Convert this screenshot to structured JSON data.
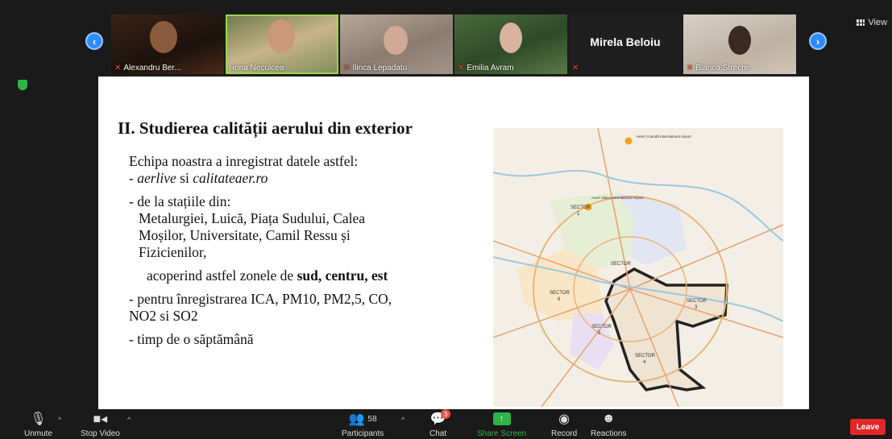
{
  "window": {
    "view_label": "View",
    "view_icon": "grid-icon"
  },
  "gallery": {
    "prev_icon": "chevron-left-icon",
    "next_icon": "chevron-right-icon",
    "participants": [
      {
        "name": "Alexandru Ber...",
        "muted": true,
        "video": true
      },
      {
        "name": "Horia Neculcea",
        "muted": false,
        "video": true,
        "active": true
      },
      {
        "name": "Ilinca Lepadatu",
        "muted": true,
        "video": true
      },
      {
        "name": "Emilia Avram",
        "muted": true,
        "video": true
      },
      {
        "name": "Mirela Beloiu",
        "muted": true,
        "video": false
      },
      {
        "name": "Bianca Streche",
        "muted": true,
        "video": true
      }
    ]
  },
  "slide": {
    "title": "II. Studierea calității aerului din exterior",
    "lines": {
      "l1": "Echipa noastra a inregistrat datele astfel:",
      "l2_prefix": "- ",
      "l2_italic1": "aerlive",
      "l2_mid": " si ",
      "l2_italic2": "calitateaer.ro",
      "l3": "- de la stațiile din:",
      "l4": "Metalurgiei, Luică, Piața Sudului, Calea",
      "l5": "Moșilor, Universitate, Camil Ressu și",
      "l6": "Fizicienilor,",
      "l7_prefix": "acoperind  astfel zonele de ",
      "l7_bold": "sud, centru, est",
      "l8": "- pentru înregistrarea ICA, PM10, PM2,5, CO,",
      "l9": "NO2 si SO2",
      "l10": "- timp de o săptămână"
    },
    "map": {
      "labels": {
        "s1a": "SECTOR",
        "s1b": "1",
        "s2": "SECTOR",
        "s3a": "SECTOR",
        "s3b": "3",
        "s4a": "SECTOR",
        "s4b": "4",
        "s5a": "SECTOR",
        "s5b": "5",
        "s6a": "SECTOR",
        "s6b": "6",
        "airport1": "Henri Coandă International Airport",
        "airport2": "Aurel Vlaicu International Airport"
      }
    }
  },
  "toolbar": {
    "unmute": "Unmute",
    "stop_video": "Stop Video",
    "participants": "Participants",
    "participants_count": "58",
    "chat": "Chat",
    "chat_badge": "3",
    "share_screen": "Share Screen",
    "record": "Record",
    "reactions": "Reactions",
    "leave": "Leave"
  },
  "colors": {
    "accent": "#2d8cff",
    "share": "#2fb447",
    "leave": "#e02828",
    "mute": "#e5533d"
  }
}
